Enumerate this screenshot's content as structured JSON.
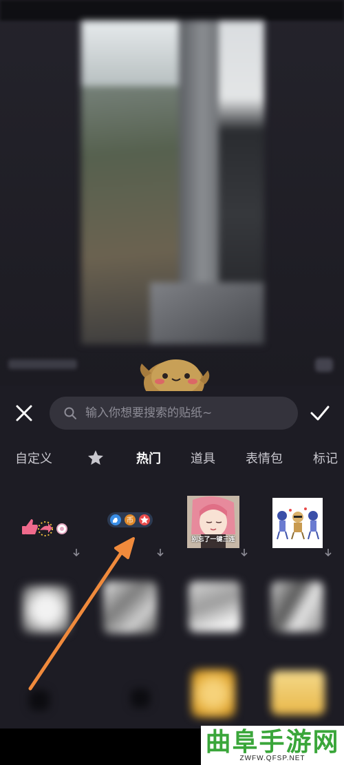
{
  "search": {
    "placeholder": "输入你想要搜索的贴纸~"
  },
  "tabs": [
    {
      "label": "自定义"
    },
    {
      "label": "热门",
      "active": true
    },
    {
      "label": "道具"
    },
    {
      "label": "表情包"
    },
    {
      "label": "标记"
    }
  ],
  "stickers": {
    "row1": [
      {
        "name": "like-share-sticker"
      },
      {
        "name": "like-coin-favorite-sticker"
      },
      {
        "name": "anime-girl-sticker",
        "caption": "别忘了一键三连"
      },
      {
        "name": "dancing-characters-sticker"
      }
    ]
  },
  "colors": {
    "background": "#1d1c24",
    "search_bg": "#34333c",
    "arrow": "#f08a3c",
    "watermark_green": "#3aa63a"
  },
  "watermark": {
    "title": "曲阜手游网",
    "url": "ZWFW.QFSP.NET"
  }
}
